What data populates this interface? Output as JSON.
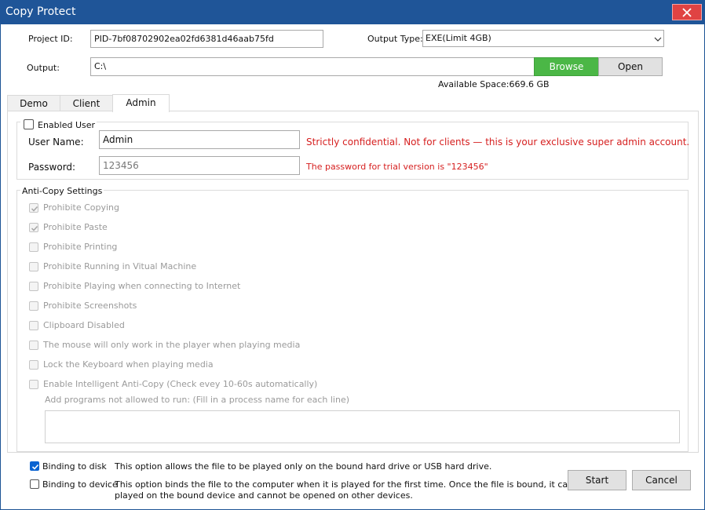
{
  "window": {
    "title": "Copy Protect"
  },
  "top": {
    "project_id_label": "Project ID:",
    "project_id_value": "PID-7bf08702902ea02fd6381d46aab75fd",
    "output_type_label": "Output Type:",
    "output_type_value": "EXE(Limit 4GB)",
    "output_label": "Output:",
    "output_value": "C:\\",
    "browse_label": "Browse",
    "open_label": "Open",
    "available_space": "Available Space:669.6 GB"
  },
  "tabs": [
    {
      "label": "Demo"
    },
    {
      "label": "Client"
    },
    {
      "label": "Admin"
    }
  ],
  "admin": {
    "enabled_user_label": "Enabled User",
    "username_label": "User Name:",
    "username_value": "Admin",
    "username_note": "Strictly confidential. Not for clients — this is your exclusive super admin account.",
    "password_label": "Password:",
    "password_value": "123456",
    "password_note": "The password for trial version is \"123456\""
  },
  "anticopy": {
    "title": "Anti-Copy Settings",
    "options": [
      {
        "label": "Prohibite Copying",
        "checked": true
      },
      {
        "label": "Prohibite Paste",
        "checked": true
      },
      {
        "label": "Prohibite Printing",
        "checked": false
      },
      {
        "label": "Prohibite Running in Vitual Machine",
        "checked": false
      },
      {
        "label": "Prohibite Playing when connecting to Internet",
        "checked": false
      },
      {
        "label": "Prohibite Screenshots",
        "checked": false
      },
      {
        "label": "Clipboard Disabled",
        "checked": false
      },
      {
        "label": "The mouse will only work in the player when playing media",
        "checked": false
      },
      {
        "label": "Lock the Keyboard when playing media",
        "checked": false
      },
      {
        "label": "Enable Intelligent Anti-Copy (Check evey 10-60s automatically)",
        "checked": false
      }
    ],
    "programs_label": "Add programs not allowed to run: (Fill in a process name for each line)"
  },
  "bottom": {
    "binding_disk_label": "Binding to disk",
    "binding_disk_desc": "This option allows the file to be played only on the bound hard drive or USB hard drive.",
    "binding_device_label": "Binding to device",
    "binding_device_desc_1": "This option binds the file to the computer when it is played for the first time. Once the file is bound, it can only be",
    "binding_device_desc_2": "played on the bound device and cannot be opened on other devices.",
    "start_label": "Start",
    "cancel_label": "Cancel"
  }
}
